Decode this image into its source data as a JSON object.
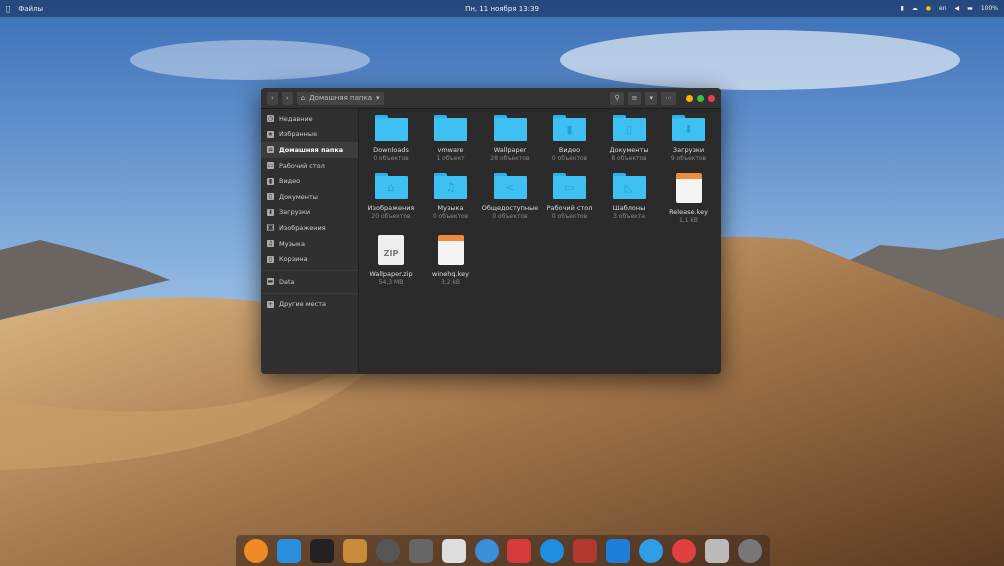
{
  "topbar": {
    "app_name": "Файлы",
    "clock": "Пн, 11 ноября 13:39",
    "lang": "en",
    "battery": "100%"
  },
  "window": {
    "path": "Домашняя папка"
  },
  "sidebar": {
    "items": [
      {
        "label": "Недавние",
        "icon": "clock-icon"
      },
      {
        "label": "Избранные",
        "icon": "star-icon"
      },
      {
        "label": "Домашняя папка",
        "icon": "home-icon",
        "active": true
      },
      {
        "label": "Рабочий стол",
        "icon": "desktop-icon"
      },
      {
        "label": "Видео",
        "icon": "video-icon"
      },
      {
        "label": "Документы",
        "icon": "documents-icon"
      },
      {
        "label": "Загрузки",
        "icon": "download-icon"
      },
      {
        "label": "Изображения",
        "icon": "camera-icon"
      },
      {
        "label": "Музыка",
        "icon": "music-icon"
      },
      {
        "label": "Корзина",
        "icon": "trash-icon"
      },
      {
        "label": "Data",
        "icon": "drive-icon"
      },
      {
        "label": "Другие места",
        "icon": "plus-icon"
      }
    ]
  },
  "files": [
    {
      "name": "Downloads",
      "count": "0 объектов",
      "type": "folder",
      "glyph": ""
    },
    {
      "name": "vmware",
      "count": "1 объект",
      "type": "folder",
      "glyph": ""
    },
    {
      "name": "Wallpaper",
      "count": "28 объектов",
      "type": "folder",
      "glyph": ""
    },
    {
      "name": "Видео",
      "count": "0 объектов",
      "type": "folder",
      "glyph": "▮"
    },
    {
      "name": "Документы",
      "count": "8 объектов",
      "type": "folder",
      "glyph": "▯"
    },
    {
      "name": "Загрузки",
      "count": "9 объектов",
      "type": "folder",
      "glyph": "⬇"
    },
    {
      "name": "Изображения",
      "count": "20 объектов",
      "type": "folder",
      "glyph": "⌂"
    },
    {
      "name": "Музыка",
      "count": "0 объектов",
      "type": "folder",
      "glyph": "♫"
    },
    {
      "name": "Общедоступные",
      "count": "0 объектов",
      "type": "folder",
      "glyph": "<"
    },
    {
      "name": "Рабочий стол",
      "count": "0 объектов",
      "type": "folder",
      "glyph": "▭"
    },
    {
      "name": "Шаблоны",
      "count": "3 объекта",
      "type": "folder",
      "glyph": "◺"
    },
    {
      "name": "Release.key",
      "count": "1,1 kB",
      "type": "key",
      "glyph": ""
    },
    {
      "name": "Wallpaper.zip",
      "count": "54,3 MB",
      "type": "zip",
      "glyph": "ZIP"
    },
    {
      "name": "winehq.key",
      "count": "3,2 kB",
      "type": "key",
      "glyph": ""
    }
  ],
  "dock": [
    {
      "name": "firefox",
      "color": "#f08a24"
    },
    {
      "name": "finder",
      "color": "#2b8fe0"
    },
    {
      "name": "terminal",
      "color": "#222"
    },
    {
      "name": "installer",
      "color": "#c98a3c"
    },
    {
      "name": "system-settings",
      "color": "#555"
    },
    {
      "name": "settings",
      "color": "#666"
    },
    {
      "name": "text-editor",
      "color": "#ddd"
    },
    {
      "name": "network",
      "color": "#3a8fd8"
    },
    {
      "name": "filezilla",
      "color": "#d63a3a"
    },
    {
      "name": "virtualbox",
      "color": "#1e8fe0"
    },
    {
      "name": "archive",
      "color": "#b03a30"
    },
    {
      "name": "writer",
      "color": "#1d7fd8"
    },
    {
      "name": "media-player",
      "color": "#2f9de8"
    },
    {
      "name": "help",
      "color": "#e04040"
    },
    {
      "name": "trash",
      "color": "#bbb"
    },
    {
      "name": "launchpad",
      "color": "#777"
    }
  ]
}
